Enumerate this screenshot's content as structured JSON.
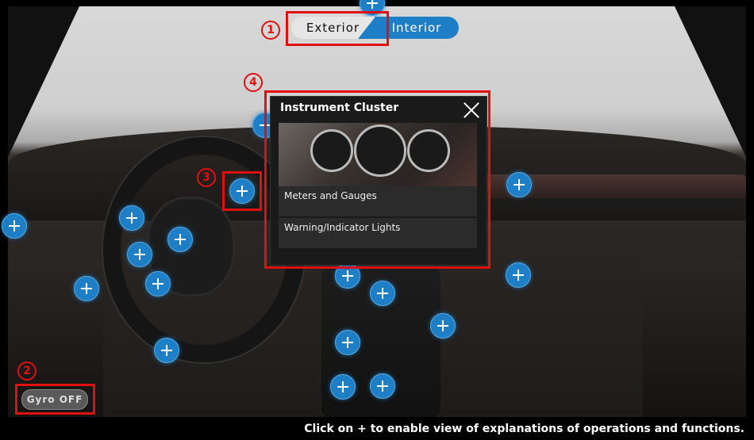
{
  "view_toggle": {
    "exterior_label": "Exterior",
    "interior_label": "Interior",
    "selected": "Interior"
  },
  "callouts": {
    "one": "1",
    "two": "2",
    "three": "3",
    "four": "4"
  },
  "gyro_button": {
    "label": "Gyro OFF"
  },
  "popup": {
    "title": "Instrument Cluster",
    "items": [
      {
        "label": "Meters and Gauges"
      },
      {
        "label": "Warning/Indicator Lights"
      }
    ]
  },
  "footer_hint": "Click on + to enable view of explanations of operations and functions.",
  "colors": {
    "accent": "#1e7fc6",
    "highlight": "#e01010"
  },
  "hotspot_icon": "plus-icon"
}
